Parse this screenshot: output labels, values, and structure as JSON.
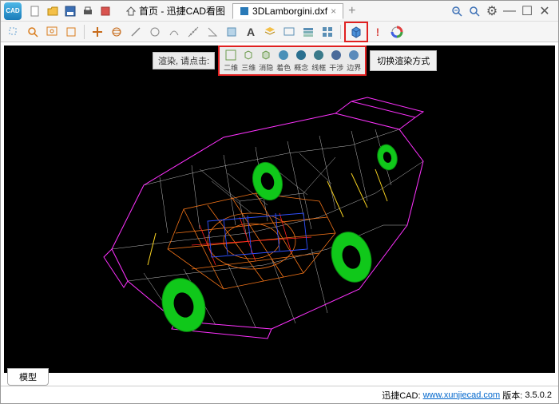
{
  "app": {
    "icon_text": "CAD"
  },
  "tabs": {
    "home": "首页 - 迅捷CAD看图",
    "file": "3DLamborgini.dxf"
  },
  "render": {
    "prompt": "渲染, 请点击:",
    "modes": [
      "二维",
      "三维",
      "消隐",
      "着色",
      "概念",
      "线框",
      "干涉",
      "边界"
    ],
    "switch": "切换渲染方式"
  },
  "bottom_tab": "模型",
  "status": {
    "brand": "迅捷CAD:",
    "url": "www.xunjiecad.com",
    "version_label": "版本:",
    "version": "3.5.0.2"
  }
}
